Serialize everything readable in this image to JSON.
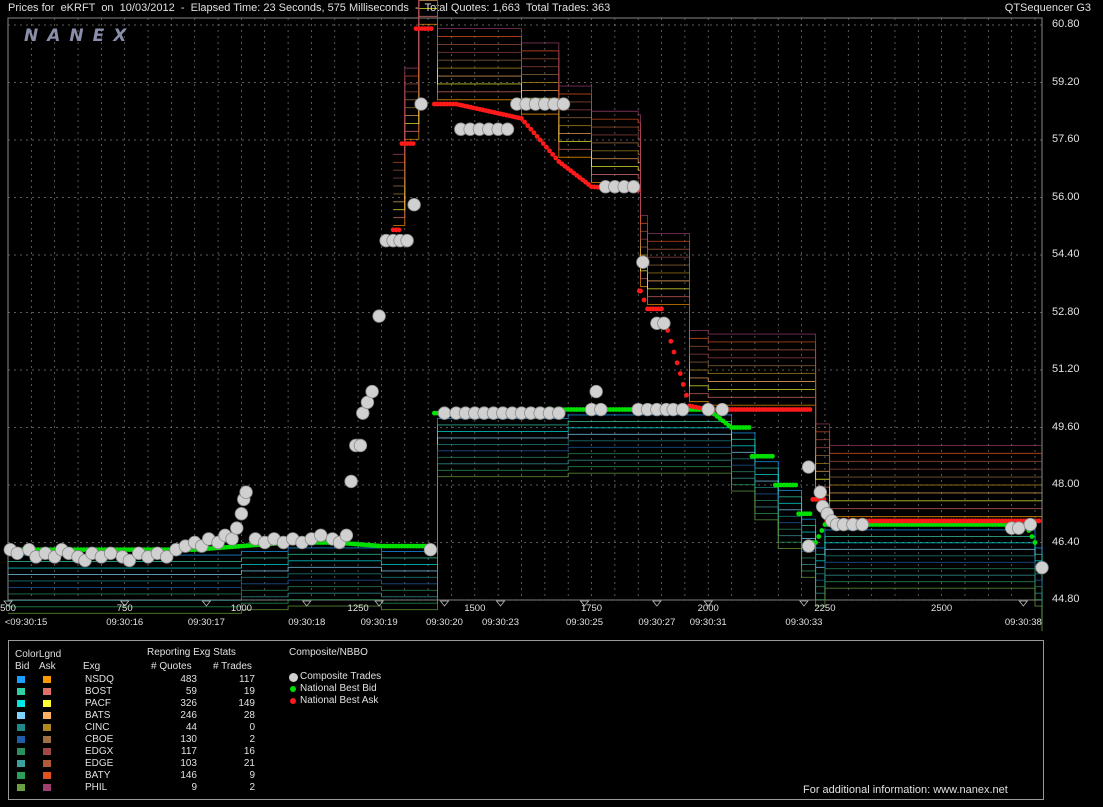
{
  "header": {
    "title": "Prices for  eKRFT  on  10/03/2012  -  Elapsed Time: 23 Seconds, 575 Milliseconds  -  Total Quotes: 1,663  Total Trades: 363",
    "product": "QTSequencer G3"
  },
  "logo": "NANEX",
  "chart_data": {
    "type": "line",
    "title": "Prices for eKRFT on 10/03/2012",
    "x_sequence_ticks": [
      "500",
      "750",
      "1000",
      "1250",
      "1500",
      "1750",
      "2000",
      "2250",
      "2500"
    ],
    "x_time_labels": [
      {
        "seq": 500,
        "label": "<09:30:15"
      },
      {
        "seq": 750,
        "label": "09:30:16"
      },
      {
        "seq": 925,
        "label": "09:30:17"
      },
      {
        "seq": 1140,
        "label": "09:30:18"
      },
      {
        "seq": 1295,
        "label": "09:30:19"
      },
      {
        "seq": 1435,
        "label": "09:30:20"
      },
      {
        "seq": 1555,
        "label": "09:30:23"
      },
      {
        "seq": 1735,
        "label": "09:30:25"
      },
      {
        "seq": 1890,
        "label": "09:30:27"
      },
      {
        "seq": 2000,
        "label": "09:30:31"
      },
      {
        "seq": 2205,
        "label": "09:30:33"
      },
      {
        "seq": 2675,
        "label": "09:30:38"
      }
    ],
    "xlim": [
      500,
      2715
    ],
    "y_ticks": [
      "44.80",
      "46.40",
      "48.00",
      "49.60",
      "51.20",
      "52.80",
      "54.40",
      "56.00",
      "57.60",
      "59.20",
      "60.80"
    ],
    "ylim": [
      44.8,
      60.8
    ],
    "grid": true,
    "series": [
      {
        "name": "Composite Trades",
        "color": "#cfcfcf",
        "marker": "circle",
        "points": [
          [
            505,
            46.2
          ],
          [
            520,
            46.1
          ],
          [
            545,
            46.2
          ],
          [
            560,
            46.0
          ],
          [
            580,
            46.1
          ],
          [
            600,
            46.0
          ],
          [
            615,
            46.2
          ],
          [
            630,
            46.1
          ],
          [
            650,
            46.0
          ],
          [
            665,
            45.9
          ],
          [
            680,
            46.1
          ],
          [
            700,
            46.0
          ],
          [
            720,
            46.1
          ],
          [
            745,
            46.0
          ],
          [
            760,
            45.9
          ],
          [
            780,
            46.1
          ],
          [
            800,
            46.0
          ],
          [
            820,
            46.1
          ],
          [
            840,
            46.0
          ],
          [
            860,
            46.2
          ],
          [
            880,
            46.3
          ],
          [
            900,
            46.4
          ],
          [
            915,
            46.3
          ],
          [
            930,
            46.5
          ],
          [
            950,
            46.4
          ],
          [
            965,
            46.6
          ],
          [
            980,
            46.5
          ],
          [
            990,
            46.8
          ],
          [
            1000,
            47.2
          ],
          [
            1005,
            47.6
          ],
          [
            1010,
            47.8
          ],
          [
            1030,
            46.5
          ],
          [
            1050,
            46.4
          ],
          [
            1070,
            46.5
          ],
          [
            1090,
            46.4
          ],
          [
            1110,
            46.5
          ],
          [
            1130,
            46.4
          ],
          [
            1150,
            46.5
          ],
          [
            1170,
            46.6
          ],
          [
            1195,
            46.5
          ],
          [
            1210,
            46.4
          ],
          [
            1225,
            46.6
          ],
          [
            1235,
            48.1
          ],
          [
            1245,
            49.1
          ],
          [
            1255,
            49.1
          ],
          [
            1260,
            50.0
          ],
          [
            1270,
            50.3
          ],
          [
            1280,
            50.6
          ],
          [
            1295,
            52.7
          ],
          [
            1310,
            54.8
          ],
          [
            1325,
            54.8
          ],
          [
            1340,
            54.8
          ],
          [
            1355,
            54.8
          ],
          [
            1370,
            55.8
          ],
          [
            1385,
            58.6
          ],
          [
            1405,
            46.2
          ],
          [
            1435,
            50.0
          ],
          [
            1460,
            50.0
          ],
          [
            1480,
            50.0
          ],
          [
            1500,
            50.0
          ],
          [
            1520,
            50.0
          ],
          [
            1540,
            50.0
          ],
          [
            1560,
            50.0
          ],
          [
            1580,
            50.0
          ],
          [
            1600,
            50.0
          ],
          [
            1620,
            50.0
          ],
          [
            1640,
            50.0
          ],
          [
            1660,
            50.0
          ],
          [
            1680,
            50.0
          ],
          [
            1470,
            57.9
          ],
          [
            1490,
            57.9
          ],
          [
            1510,
            57.9
          ],
          [
            1530,
            57.9
          ],
          [
            1550,
            57.9
          ],
          [
            1570,
            57.9
          ],
          [
            1590,
            58.6
          ],
          [
            1610,
            58.6
          ],
          [
            1630,
            58.6
          ],
          [
            1650,
            58.6
          ],
          [
            1670,
            58.6
          ],
          [
            1690,
            58.6
          ],
          [
            1750,
            50.1
          ],
          [
            1770,
            50.1
          ],
          [
            1760,
            50.6
          ],
          [
            1780,
            56.3
          ],
          [
            1800,
            56.3
          ],
          [
            1820,
            56.3
          ],
          [
            1840,
            56.3
          ],
          [
            1850,
            50.1
          ],
          [
            1870,
            50.1
          ],
          [
            1890,
            50.1
          ],
          [
            1910,
            50.1
          ],
          [
            1925,
            50.1
          ],
          [
            1945,
            50.1
          ],
          [
            1860,
            54.2
          ],
          [
            1890,
            52.5
          ],
          [
            1905,
            52.5
          ],
          [
            2000,
            50.1
          ],
          [
            2030,
            50.1
          ],
          [
            2215,
            46.3
          ],
          [
            2215,
            48.5
          ],
          [
            2240,
            47.8
          ],
          [
            2245,
            47.4
          ],
          [
            2255,
            47.2
          ],
          [
            2265,
            47.0
          ],
          [
            2275,
            46.9
          ],
          [
            2290,
            46.9
          ],
          [
            2310,
            46.9
          ],
          [
            2330,
            46.9
          ],
          [
            2650,
            46.8
          ],
          [
            2665,
            46.8
          ],
          [
            2690,
            46.9
          ],
          [
            2715,
            45.7
          ]
        ]
      },
      {
        "name": "National Best Bid",
        "color": "#00e000",
        "marker": "dot",
        "points": [
          [
            500,
            46.2
          ],
          [
            760,
            46.2
          ],
          [
            900,
            46.2
          ],
          [
            1000,
            46.3
          ],
          [
            1100,
            46.4
          ],
          [
            1200,
            46.4
          ],
          [
            1300,
            46.3
          ],
          [
            1400,
            46.3
          ],
          [
            1420,
            50.0
          ],
          [
            1700,
            50.1
          ],
          [
            1900,
            50.1
          ],
          [
            2000,
            50.1
          ],
          [
            2050,
            49.6
          ],
          [
            2100,
            48.8
          ],
          [
            2150,
            48.0
          ],
          [
            2200,
            47.2
          ],
          [
            2230,
            46.4
          ],
          [
            2250,
            46.9
          ],
          [
            2500,
            46.9
          ],
          [
            2680,
            46.9
          ],
          [
            2700,
            46.4
          ],
          [
            2715,
            45.7
          ]
        ]
      },
      {
        "name": "National Best Ask",
        "color": "#ff1a1a",
        "marker": "dot",
        "points": [
          [
            1325,
            55.1
          ],
          [
            1350,
            57.5
          ],
          [
            1380,
            60.7
          ],
          [
            1420,
            58.6
          ],
          [
            1460,
            58.6
          ],
          [
            1600,
            58.2
          ],
          [
            1680,
            57.0
          ],
          [
            1750,
            56.3
          ],
          [
            1850,
            56.2
          ],
          [
            1855,
            53.4
          ],
          [
            1870,
            52.9
          ],
          [
            1900,
            52.9
          ],
          [
            1960,
            50.2
          ],
          [
            2000,
            50.1
          ],
          [
            2200,
            50.1
          ],
          [
            2230,
            47.6
          ],
          [
            2260,
            47.0
          ],
          [
            2300,
            47.0
          ],
          [
            2500,
            47.0
          ],
          [
            2715,
            47.0
          ]
        ]
      }
    ]
  },
  "legend": {
    "colorlgnd": "ColorLgnd",
    "bid_header": "Bid",
    "ask_header": "Ask",
    "exg_header": "Exg",
    "stats_title": "Reporting Exg Stats",
    "quotes_header": "# Quotes",
    "trades_header": "# Trades",
    "composite_title": "Composite/NBBO",
    "rows": [
      {
        "exg": "NSDQ",
        "quotes": "483",
        "trades": "117",
        "bid_color": "#1aa0ff",
        "ask_color": "#ff9900"
      },
      {
        "exg": "BOST",
        "quotes": "59",
        "trades": "19",
        "bid_color": "#2fd0a8",
        "ask_color": "#e0706a"
      },
      {
        "exg": "PACF",
        "quotes": "326",
        "trades": "149",
        "bid_color": "#00e5e5",
        "ask_color": "#ffff33"
      },
      {
        "exg": "BATS",
        "quotes": "246",
        "trades": "28",
        "bid_color": "#7fd4ff",
        "ask_color": "#ffb060"
      },
      {
        "exg": "CINC",
        "quotes": "44",
        "trades": "0",
        "bid_color": "#1f8a8a",
        "ask_color": "#b08820"
      },
      {
        "exg": "CBOE",
        "quotes": "130",
        "trades": "2",
        "bid_color": "#1f5fa8",
        "ask_color": "#a07040"
      },
      {
        "exg": "EDGX",
        "quotes": "117",
        "trades": "16",
        "bid_color": "#2a9060",
        "ask_color": "#a04848"
      },
      {
        "exg": "EDGE",
        "quotes": "103",
        "trades": "21",
        "bid_color": "#3aa0a0",
        "ask_color": "#b05a3a"
      },
      {
        "exg": "BATY",
        "quotes": "146",
        "trades": "9",
        "bid_color": "#2aa05a",
        "ask_color": "#e05020"
      },
      {
        "exg": "PHIL",
        "quotes": "9",
        "trades": "2",
        "bid_color": "#6aa040",
        "ask_color": "#a04070"
      }
    ],
    "composite_items": [
      {
        "label": "Composite Trades",
        "color": "#cfcfcf"
      },
      {
        "label": "National Best Bid",
        "color": "#00e000"
      },
      {
        "label": "National Best Ask",
        "color": "#ff1a1a"
      }
    ]
  },
  "footer": "For additional information: www.nanex.net"
}
